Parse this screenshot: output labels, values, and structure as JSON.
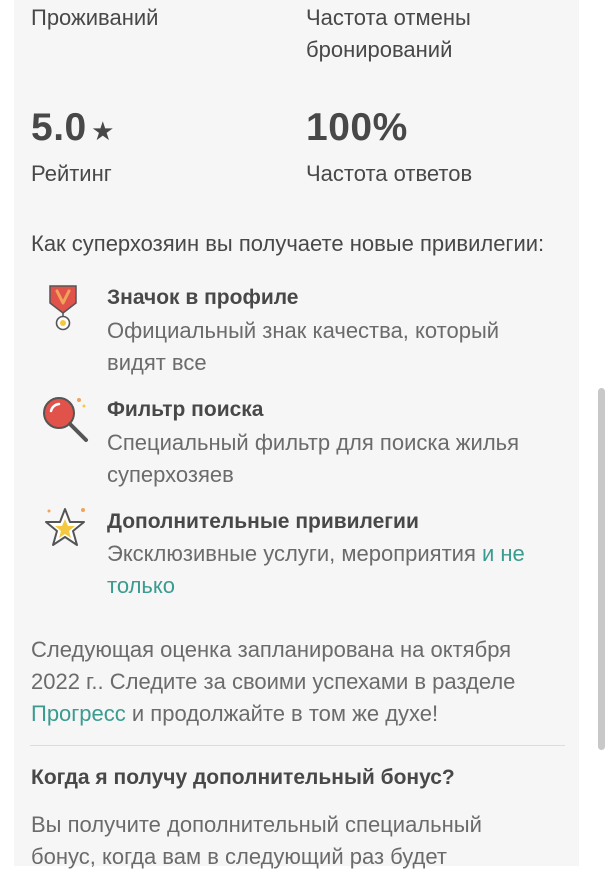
{
  "stats": {
    "stays_label": "Проживаний",
    "cancel_label_line1": "Частота отмены",
    "cancel_label_line2": "бронирований",
    "rating_value": "5.0",
    "rating_star": "★",
    "rating_label": "Рейтинг",
    "response_value": "100%",
    "response_label": "Частота ответов"
  },
  "perks_intro": "Как суперхозяин вы получаете новые привилегии:",
  "perks": [
    {
      "icon": "medal-icon",
      "title": "Значок в профиле",
      "desc_line1": "Официальный знак качества, который",
      "desc_line2": "видят все"
    },
    {
      "icon": "magnifier-icon",
      "title": "Фильтр поиска",
      "desc_line1": "Специальный фильтр для поиска жилья",
      "desc_line2": "суперхозяев"
    },
    {
      "icon": "star-icon",
      "title": "Дополнительные привилегии",
      "desc_line1": "Эксклюзивные услуги, мероприятия",
      "desc_link1": "и не",
      "desc_link2": "только"
    }
  ],
  "next_review": {
    "line1": "Следующая оценка запланирована на октября",
    "line2": "2022 г.. Следите за своими успехами в разделе",
    "link": "Прогресс",
    "line3_rest": " и продолжайте в том же духе!"
  },
  "bonus": {
    "question": "Когда я получу дополнительный бонус?",
    "answer_line1": "Вы получите дополнительный специальный",
    "answer_line2": "бонус, когда вам в следующий раз будет"
  },
  "colors": {
    "accent_link": "#3a9b8f",
    "icon_red": "#e0524a",
    "icon_orange": "#f1a35a",
    "icon_gold": "#f5c842"
  }
}
